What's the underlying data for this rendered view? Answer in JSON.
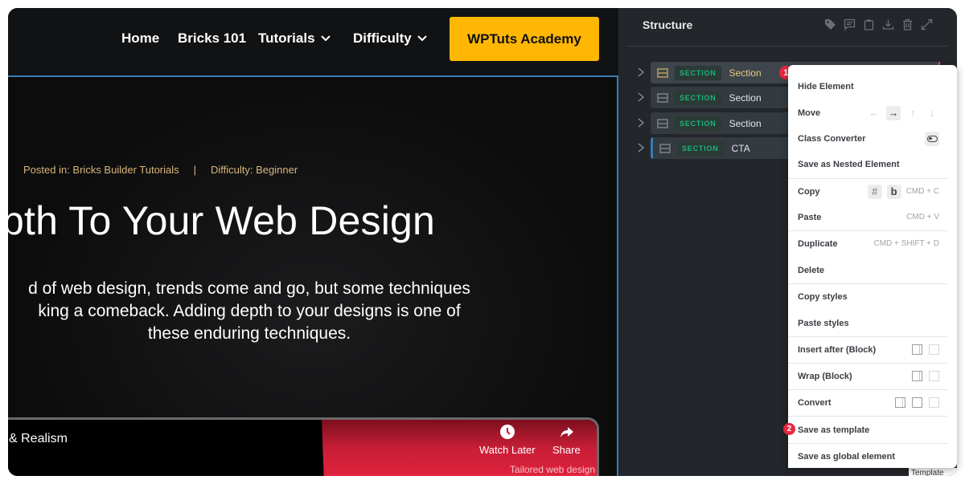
{
  "site_nav": {
    "links": [
      {
        "label": "Home",
        "has_dropdown": false
      },
      {
        "label": "Bricks 101",
        "has_dropdown": false
      },
      {
        "label": "Tutorials",
        "has_dropdown": true
      },
      {
        "label": "Difficulty",
        "has_dropdown": true
      }
    ],
    "cta_label": "WPTuts Academy",
    "cta_color": "#ffb703"
  },
  "hero": {
    "posted_in": "Posted in: Bricks Builder Tutorials",
    "separator": "|",
    "difficulty": "Difficulty: Beginner",
    "headline": "pth To Your Web Design",
    "subtext_lines": [
      "d of web design, trends come and go, but some techniques",
      "king a comeback. Adding depth to your designs is one of",
      "these enduring techniques."
    ]
  },
  "video": {
    "title": "& Realism",
    "watch_later_label": "Watch Later",
    "share_label": "Share",
    "tagline": "Tailored web design"
  },
  "structure_panel": {
    "title": "Structure",
    "tools": [
      "tag-icon",
      "comment-icon",
      "clipboard-icon",
      "download-icon",
      "trash-icon",
      "expand-icon"
    ],
    "rows": [
      {
        "tag": "SECTION",
        "label": "Section",
        "active": true,
        "badge": "1"
      },
      {
        "tag": "SECTION",
        "label": "Section",
        "active": false
      },
      {
        "tag": "SECTION",
        "label": "Section",
        "active": false
      },
      {
        "tag": "SECTION",
        "label": "CTA",
        "active": false
      }
    ]
  },
  "context_menu": {
    "items": [
      {
        "label": "Hide Element"
      },
      {
        "label": "Move",
        "arrows": [
          "←",
          "→",
          "↑",
          "↓"
        ],
        "active_arrow": "→"
      },
      {
        "label": "Class Converter"
      },
      {
        "label": "Save as Nested Element"
      },
      {
        "label": "Copy",
        "keys": [
          "#",
          "b"
        ],
        "shortcut": "CMD + C"
      },
      {
        "label": "Paste",
        "shortcut": "CMD + V"
      },
      {
        "label": "Duplicate",
        "shortcut": "CMD + SHIFT + D"
      },
      {
        "label": "Delete"
      },
      {
        "label": "Copy styles"
      },
      {
        "label": "Paste styles"
      },
      {
        "label": "Insert after (Block)"
      },
      {
        "label": "Wrap (Block)"
      },
      {
        "label": "Convert"
      },
      {
        "label": "Save as template",
        "badge": "2"
      },
      {
        "label": "Save as global element"
      }
    ],
    "footer_tab": "Template"
  },
  "colors": {
    "badge_red": "#e7283f",
    "section_tag_green": "#18b67c",
    "active_label_gold": "#e7cb82",
    "selection_blue": "#3a7bb5"
  }
}
